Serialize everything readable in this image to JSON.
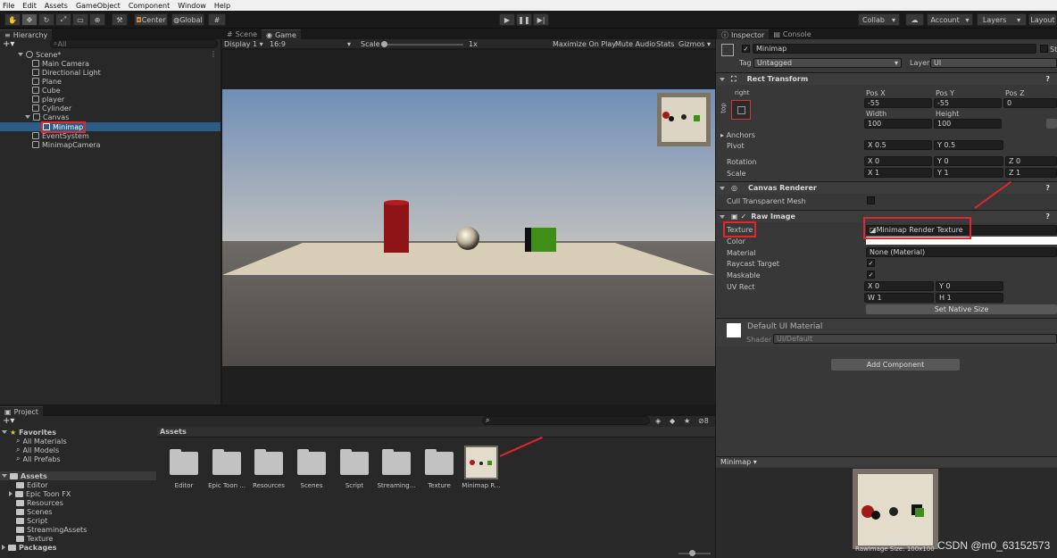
{
  "menu": [
    "File",
    "Edit",
    "Assets",
    "GameObject",
    "Component",
    "Window",
    "Help"
  ],
  "toolbar": {
    "center": "Center",
    "global": "Global",
    "collab": "Collab",
    "account": "Account",
    "layers": "Layers",
    "layout": "Layout"
  },
  "hierarchy": {
    "tab": "Hierarchy",
    "search_placeholder": "All",
    "scene": "Scene*",
    "items": [
      "Main Camera",
      "Directional Light",
      "Plane",
      "Cube",
      "player",
      "Cylinder",
      "Canvas",
      "Minimap",
      "EventSystem",
      "MinimapCamera"
    ]
  },
  "scene_tabs": {
    "scene": "Scene",
    "game": "Game"
  },
  "game_bar": {
    "display": "Display 1",
    "aspect": "16:9",
    "scale_label": "Scale",
    "scale_value": "1x",
    "maximize": "Maximize On Play",
    "mute": "Mute Audio",
    "stats": "Stats",
    "gizmos": "Gizmos"
  },
  "inspector": {
    "tab_inspector": "Inspector",
    "tab_console": "Console",
    "object_name": "Minimap",
    "static_label": "Sta",
    "tag_label": "Tag",
    "tag_value": "Untagged",
    "layer_label": "Layer",
    "layer_value": "UI",
    "rect_transform": {
      "title": "Rect Transform",
      "anchor_preset_top": "right",
      "anchor_preset_side": "top",
      "posx_label": "Pos X",
      "posx": "-55",
      "posy_label": "Pos Y",
      "posy": "-55",
      "posz_label": "Pos Z",
      "posz": "0",
      "width_label": "Width",
      "width": "100",
      "height_label": "Height",
      "height": "100",
      "anchors": "Anchors",
      "pivot": "Pivot",
      "pivot_x": "0.5",
      "pivot_y": "0.5",
      "rotation": "Rotation",
      "rot_x": "0",
      "rot_y": "0",
      "rot_z": "0",
      "scale": "Scale",
      "scale_x": "1",
      "scale_y": "1",
      "scale_z": "1"
    },
    "canvas_renderer": {
      "title": "Canvas Renderer",
      "cull": "Cull Transparent Mesh"
    },
    "raw_image": {
      "title": "Raw Image",
      "texture_label": "Texture",
      "texture_value": "Minimap Render Texture",
      "color_label": "Color",
      "material_label": "Material",
      "material_value": "None (Material)",
      "raycast_label": "Raycast Target",
      "maskable_label": "Maskable",
      "uvrect_label": "UV Rect",
      "uv_x": "0",
      "uv_y": "0",
      "uv_w": "1",
      "uv_h": "1",
      "native": "Set Native Size"
    },
    "material": {
      "name": "Default UI Material",
      "shader_label": "Shader",
      "shader_value": "UI/Default"
    },
    "add_component": "Add Component",
    "preview_title": "Minimap",
    "preview_caption1": "Minimap",
    "preview_caption2": "RawImage Size: 100x100"
  },
  "project": {
    "tab": "Project",
    "favorites": "Favorites",
    "fav_items": [
      "All Materials",
      "All Models",
      "All Prefabs"
    ],
    "assets": "Assets",
    "asset_tree": [
      "Editor",
      "Epic Toon FX",
      "Resources",
      "Scenes",
      "Script",
      "StreamingAssets",
      "Texture"
    ],
    "packages": "Packages",
    "breadcrumb": "Assets",
    "hidden_count": "8",
    "grid": [
      "Editor",
      "Epic Toon ...",
      "Resources",
      "Scenes",
      "Script",
      "Streaming...",
      "Texture",
      "Minimap R..."
    ]
  },
  "watermark": "CSDN @m0_63152573",
  "colors": {
    "highlight": "#e0262e",
    "selection": "#2c5d87"
  }
}
